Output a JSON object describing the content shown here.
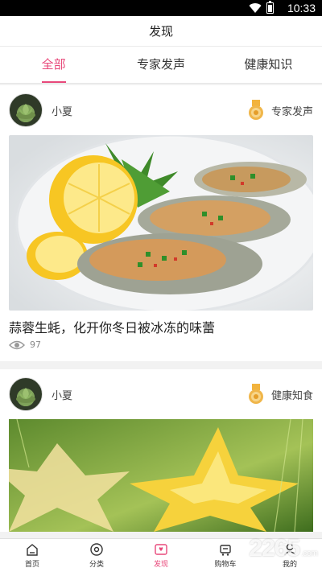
{
  "status": {
    "time": "10:33"
  },
  "header": {
    "title": "发现"
  },
  "tabs": [
    {
      "label": "全部",
      "active": true
    },
    {
      "label": "专家发声",
      "active": false
    },
    {
      "label": "健康知识",
      "active": false
    }
  ],
  "feed": [
    {
      "author": "小夏",
      "tag": "专家发声",
      "title": "蒜蓉生蚝，化开你冬日被冰冻的味蕾",
      "views": "97"
    },
    {
      "author": "小夏",
      "tag": "健康知食"
    }
  ],
  "nav": [
    {
      "label": "首页",
      "icon": "home-icon"
    },
    {
      "label": "分类",
      "icon": "category-icon"
    },
    {
      "label": "发现",
      "icon": "discover-icon",
      "active": true
    },
    {
      "label": "购物车",
      "icon": "cart-icon"
    },
    {
      "label": "我的",
      "icon": "profile-icon"
    }
  ],
  "watermark": {
    "brand": "2265",
    "suffix": ".com"
  },
  "colors": {
    "accent": "#e8487a",
    "statusbar": "#000000"
  }
}
